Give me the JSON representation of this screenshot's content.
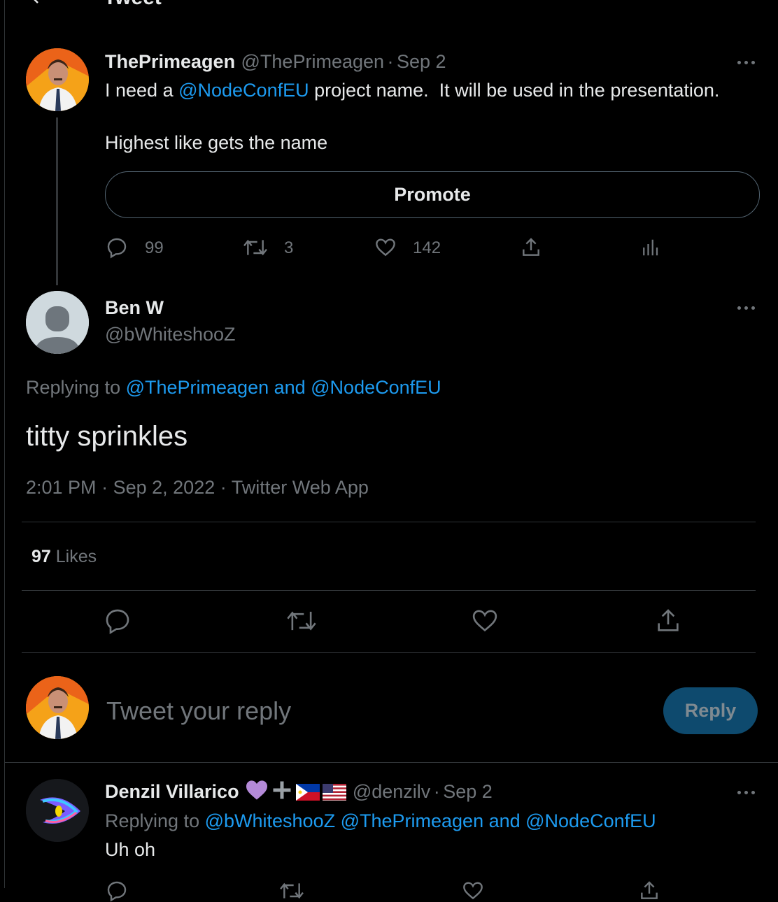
{
  "header": {
    "title": "Tweet"
  },
  "parent_tweet": {
    "name": "ThePrimeagen",
    "handle": "@ThePrimeagen",
    "sep": "·",
    "date": "Sep 2",
    "text_a": "I need a ",
    "mention": "@NodeConfEU",
    "text_b": " project name.  It will be used in the presentation.",
    "text_line2": "Highest like gets the name",
    "promote_label": "Promote",
    "reply_count": "99",
    "retweet_count": "3",
    "like_count": "142"
  },
  "main_tweet": {
    "name": "Ben W",
    "handle": "@bWhiteshooZ",
    "replying_prefix": "Replying to ",
    "replying_targets": "@ThePrimeagen and @NodeConfEU",
    "text": "titty sprinkles",
    "meta_time": "2:01 PM",
    "meta_sep1": "·",
    "meta_date": "Sep 2, 2022",
    "meta_sep2": "·",
    "meta_source": "Twitter Web App",
    "likes_count": "97",
    "likes_label": "Likes"
  },
  "reply_box": {
    "placeholder": "Tweet your reply",
    "button_label": "Reply"
  },
  "reply_tweet": {
    "name": "Denzil Villarico",
    "handle": "@denzilv",
    "sep": "·",
    "date": "Sep 2",
    "replying_prefix": "Replying to ",
    "replying_targets": "@bWhiteshooZ @ThePrimeagen and @NodeConfEU",
    "text": "Uh oh"
  },
  "colors": {
    "accent": "#1d9bf0",
    "muted": "#71767b",
    "divider": "#2f3336",
    "reply_button": "#0e4a6e"
  }
}
